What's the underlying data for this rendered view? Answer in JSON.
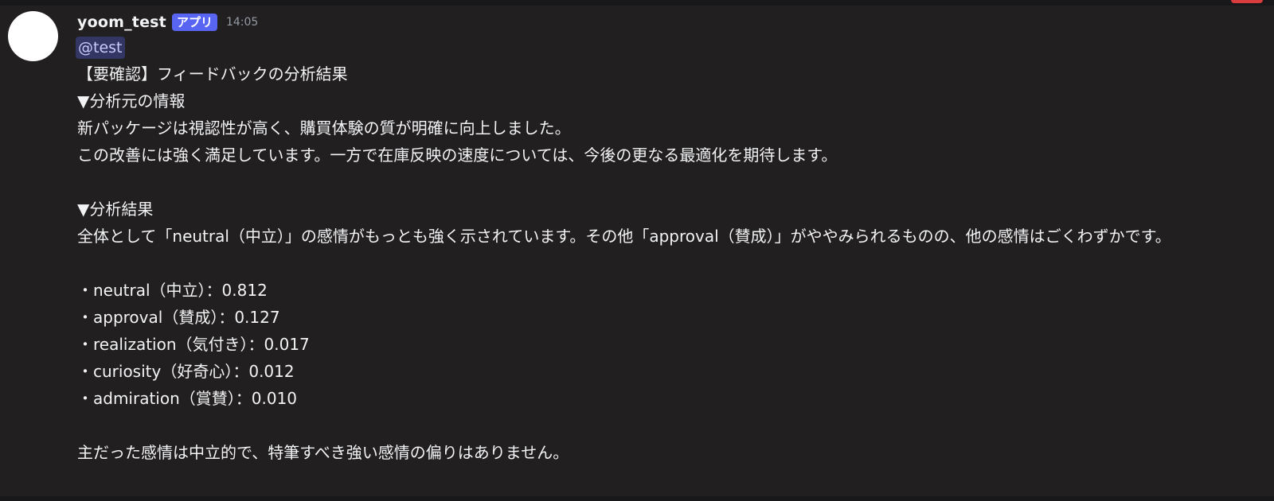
{
  "message": {
    "author": "yoom_test",
    "badge": "アプリ",
    "timestamp": "14:05",
    "mention": "@test",
    "title": "【要確認】フィードバックの分析結果",
    "source_heading": "▼分析元の情報",
    "source_lines": [
      "新パッケージは視認性が高く、購買体験の質が明確に向上しました。",
      "この改善には強く満足しています。一方で在庫反映の速度については、今後の更なる最適化を期待します。"
    ],
    "result_heading": "▼分析結果",
    "summary": "全体として「neutral（中立）」の感情がもっとも強く示されています。その他「approval（賛成）」がややみられるものの、他の感情はごくわずかです。",
    "emotions": [
      "・neutral（中立）：0.812",
      "・approval（賛成）：0.127",
      "・realization（気付き）：0.017",
      "・curiosity（好奇心）：0.012",
      "・admiration（賞賛）：0.010"
    ],
    "conclusion": "主だった感情は中立的で、特筆すべき強い感情の偏りはありません。"
  },
  "colors": {
    "background": "#221f20",
    "badge": "#5865f2",
    "mention_text": "#c9cdfb",
    "timestamp": "#949ba4"
  }
}
